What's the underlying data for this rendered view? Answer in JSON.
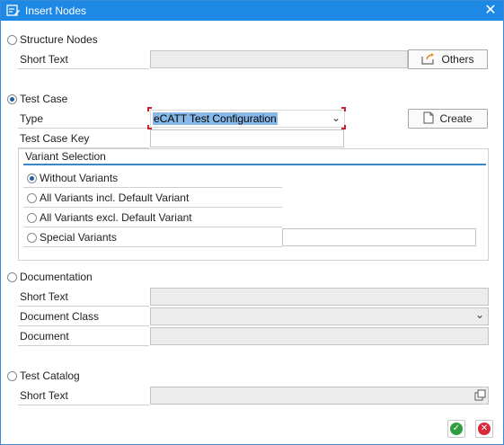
{
  "window": {
    "title": "Insert Nodes"
  },
  "structure_nodes": {
    "label": "Structure Nodes",
    "short_text_label": "Short Text",
    "short_text_value": "",
    "others_button": "Others"
  },
  "test_case": {
    "label": "Test Case",
    "type_label": "Type",
    "type_value": "eCATT Test Configuration",
    "create_button": "Create",
    "key_label": "Test Case Key",
    "key_value": "",
    "variant_selection": {
      "title": "Variant Selection",
      "options": [
        "Without Variants",
        "All Variants incl. Default Variant",
        "All Variants excl. Default Variant",
        "Special Variants"
      ],
      "special_value": ""
    }
  },
  "documentation": {
    "label": "Documentation",
    "short_text_label": "Short Text",
    "short_text_value": "",
    "doc_class_label": "Document Class",
    "doc_class_value": "",
    "document_label": "Document",
    "document_value": ""
  },
  "test_catalog": {
    "label": "Test Catalog",
    "short_text_label": "Short Text",
    "short_text_value": ""
  },
  "selected_node_type": "Test Case",
  "selected_variant": "Without Variants",
  "colors": {
    "titlebar": "#1e88e5",
    "accent": "#3a86c8",
    "ok": "#2e9e3e",
    "cancel": "#d8283a"
  }
}
